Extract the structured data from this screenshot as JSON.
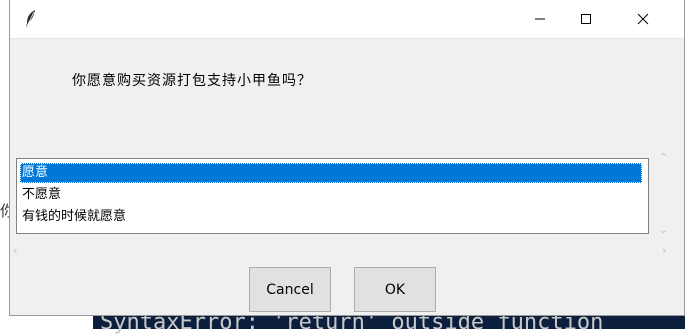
{
  "background": {
    "terminal_text": "SyntaxError: 'return' outside function",
    "side_glyph": "你"
  },
  "dialog": {
    "prompt": "你愿意购买资源打包支持小甲鱼吗？",
    "options": [
      "愿意",
      "不愿意",
      "有钱的时候就愿意"
    ],
    "selected_index": 0,
    "buttons": {
      "cancel_label": "Cancel",
      "ok_label": "OK"
    }
  },
  "colors": {
    "selection": "#0078d7",
    "dialog_bg": "#f0f0f0",
    "terminal_bg": "#0c1f3f"
  },
  "icons": [
    "feather-icon",
    "minimize-icon",
    "maximize-icon",
    "close-icon",
    "scroll-up-icon",
    "scroll-down-icon",
    "scroll-left-icon",
    "scroll-right-icon"
  ]
}
